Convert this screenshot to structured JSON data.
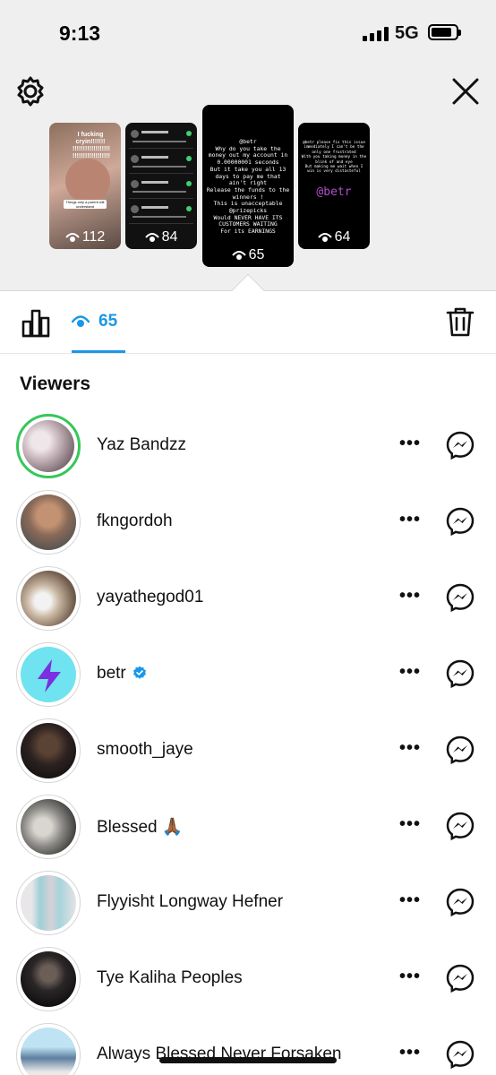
{
  "status_bar": {
    "time": "9:13",
    "network": "5G"
  },
  "stories": [
    {
      "views": "112",
      "caption": "I fucking cryin!!!!!!! !!!!!!!!!!!!!!!!!! !!!!!!!!!!!!!!!!!!",
      "note": "Things only a parent will understand"
    },
    {
      "views": "84"
    },
    {
      "views": "65",
      "text": "@betr\nWhy do you take the money out my account in 0.00000001 seconds\nBut it take you all 13 days to pay me that ain't right\nRelease the funds to the winners !\nThis is unacceptable\n@prizepicks\nWould NEVER HAVE ITS CUSTOMERS WAITING\nFor its EARNINGS"
    },
    {
      "views": "64",
      "text": "@betr please fix this issue immediately I can't be the only one frustrated\nWith you taking money in the blink of and eye\nBut making me wait when I win is very distasteful",
      "tag": "@betr"
    }
  ],
  "tabs": {
    "views_count": "65"
  },
  "section_title": "Viewers",
  "viewers": [
    {
      "name": "Yaz Bandzz",
      "has_story_ring": true,
      "verified": false
    },
    {
      "name": "fkngordoh",
      "has_story_ring": false,
      "verified": false
    },
    {
      "name": "yayathegod01",
      "has_story_ring": false,
      "verified": false
    },
    {
      "name": "betr",
      "has_story_ring": false,
      "verified": true
    },
    {
      "name": "smooth_jaye",
      "has_story_ring": false,
      "verified": false
    },
    {
      "name": "Blessed 🙏🏾",
      "has_story_ring": false,
      "verified": false
    },
    {
      "name": "Flyyisht Longway Hefner",
      "has_story_ring": false,
      "verified": false
    },
    {
      "name": "Tye Kaliha Peoples",
      "has_story_ring": false,
      "verified": false
    },
    {
      "name": "Always Blessed Never Forsaken",
      "has_story_ring": false,
      "verified": false
    }
  ],
  "colors": {
    "accent": "#1a97e8",
    "story_ring": "#35c759",
    "verified": "#1a97e8",
    "betr_purple": "#7b2fe0",
    "betr_bg": "#6fe3ef"
  },
  "icons": [
    "settings-icon",
    "close-icon",
    "insights-icon",
    "eye-icon",
    "trash-icon",
    "more-icon",
    "messenger-icon",
    "verified-icon"
  ]
}
